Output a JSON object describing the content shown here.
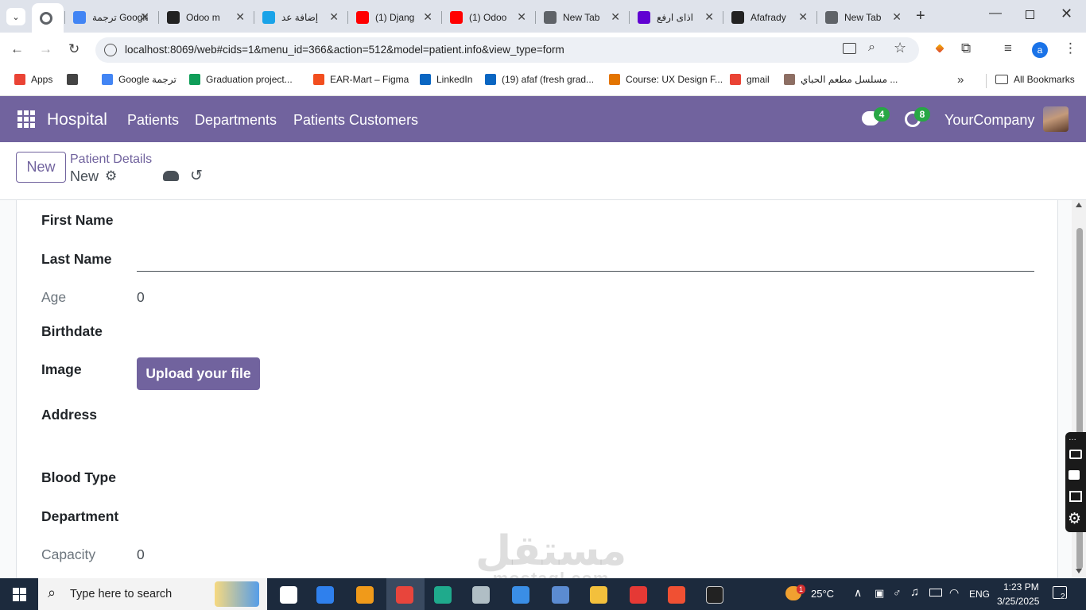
{
  "browser": {
    "tabs": [
      {
        "title": "",
        "active": true,
        "color": "#5f6368"
      },
      {
        "title": "ترجمة Google",
        "color": "#4285f4"
      },
      {
        "title": "Odoo m",
        "color": "#222222"
      },
      {
        "title": "إضافة عد",
        "color": "#1aa3e8"
      },
      {
        "title": "(1) Djang",
        "color": "#ff0000"
      },
      {
        "title": "(1) Odoo",
        "color": "#ff0000"
      },
      {
        "title": "New Tab",
        "color": "#5f6368"
      },
      {
        "title": "اذاى ارفع",
        "color": "#6001d2"
      },
      {
        "title": "Afafrady",
        "color": "#222222"
      },
      {
        "title": "New Tab",
        "color": "#5f6368"
      }
    ],
    "url": "localhost:8069/web#cids=1&menu_id=366&action=512&model=patient.info&view_type=form",
    "profile_initial": "a",
    "bookmarks": [
      {
        "label": "Apps",
        "color": "#ea4335"
      },
      {
        "label": "",
        "color": "#444444"
      },
      {
        "label": "Google ترجمة",
        "color": "#4285f4"
      },
      {
        "label": "Graduation project...",
        "color": "#0f9d58"
      },
      {
        "label": "EAR-Mart – Figma",
        "color": "#f24e1e"
      },
      {
        "label": "LinkedIn",
        "color": "#0a66c2"
      },
      {
        "label": "(19) afaf (fresh grad...",
        "color": "#0a66c2"
      },
      {
        "label": "Course: UX Design F...",
        "color": "#e37400"
      },
      {
        "label": "gmail",
        "color": "#ea4335"
      },
      {
        "label": "مسلسل مطعم الحباي ...",
        "color": "#8d6e63"
      }
    ],
    "all_bookmarks": "All Bookmarks"
  },
  "navbar": {
    "app_name": "Hospital",
    "menu": [
      "Patients",
      "Departments",
      "Patients Customers"
    ],
    "messages_count": "4",
    "activities_count": "8",
    "company": "YourCompany"
  },
  "control": {
    "new_label": "New",
    "breadcrumb": "Patient Details",
    "record_name": "New"
  },
  "form": {
    "first_name_label": "First Name",
    "last_name_label": "Last Name",
    "age_label": "Age",
    "age_value": "0",
    "birthdate_label": "Birthdate",
    "image_label": "Image",
    "upload_label": "Upload your file",
    "address_label": "Address",
    "blood_type_label": "Blood Type",
    "department_label": "Department",
    "capacity_label": "Capacity",
    "capacity_value": "0"
  },
  "watermark": {
    "line1": "مستقل",
    "line2": "mostaql.com"
  },
  "taskbar": {
    "search_placeholder": "Type here to search",
    "weather": "25°C",
    "weather_badge": "1",
    "lang": "ENG",
    "time": "1:23 PM",
    "date": "3/25/2025",
    "notifications": "2"
  },
  "colors": {
    "brand": "#71639e",
    "badge": "#28a745"
  }
}
